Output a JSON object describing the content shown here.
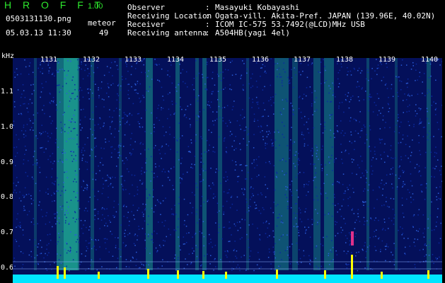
{
  "header": {
    "app_title": "H R O F F T",
    "app_version": "1.00",
    "file_name": "0503131130.png",
    "timestamp": "05.03.13 11:30",
    "meteor_label": "meteor",
    "meteor_count": "49"
  },
  "station_info": [
    {
      "label": "Observer",
      "sep": ":",
      "value": "Masayuki Kobayashi"
    },
    {
      "label": "Receiving Location",
      "sep": ":",
      "value": "Ogata-vill. Akita-Pref. JAPAN (139.96E, 40.02N)"
    },
    {
      "label": "Receiver",
      "sep": ":",
      "value": "ICOM IC-575 53.7492(@LCD)MHz USB"
    },
    {
      "label": "Receiving antenna",
      "sep": ":",
      "value": "A504HB(yagi 4el)"
    }
  ],
  "spectrogram": {
    "y_unit": "kHz",
    "y_ticks": [
      "1.1",
      "1.0",
      "0.9",
      "0.8",
      "0.7",
      "0.6"
    ],
    "minute_labels": [
      "1131",
      "1132",
      "1133",
      "1134",
      "1135",
      "1136",
      "1137",
      "1138",
      "1139",
      "1140"
    ],
    "background_color": "#04105a",
    "echo_color": "#1fb89a",
    "baseline_color": "#00e5ff",
    "meteor_spike_color": "#ffff00"
  }
}
